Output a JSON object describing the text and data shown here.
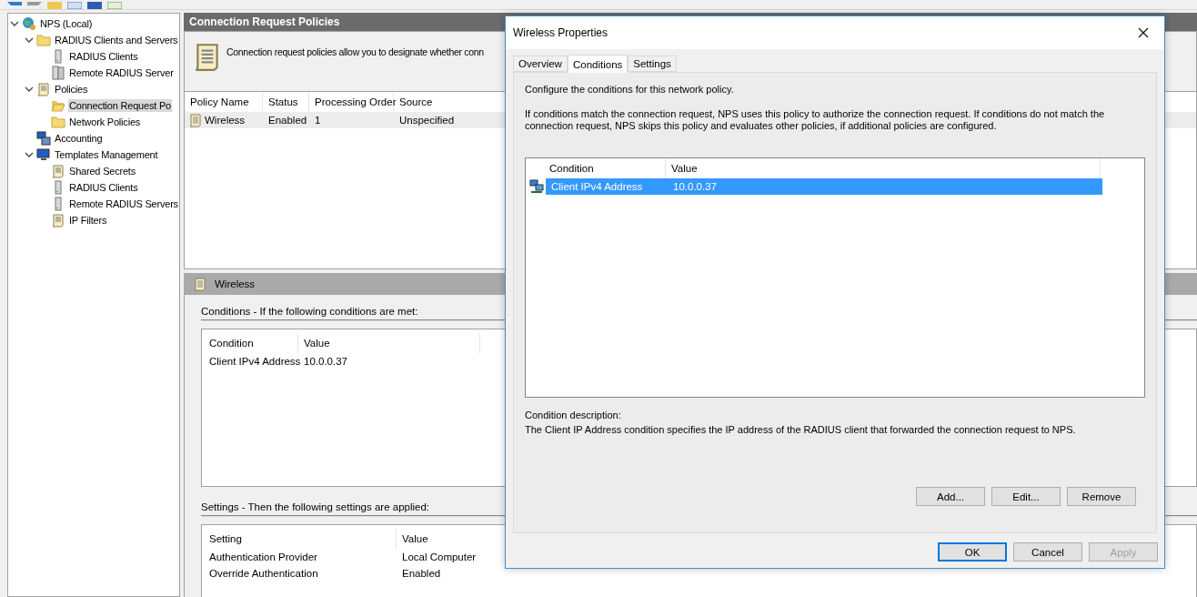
{
  "tree": [
    {
      "label": "NPS (Local)",
      "kind": "globe",
      "selected": false,
      "expanded": true,
      "children": [
        {
          "label": "RADIUS Clients and Servers",
          "kind": "folder",
          "selected": false,
          "expanded": true,
          "children": [
            {
              "label": "RADIUS Clients",
              "kind": "server",
              "selected": false
            },
            {
              "label": "Remote RADIUS Server",
              "kind": "servers",
              "selected": false
            }
          ]
        },
        {
          "label": "Policies",
          "kind": "scroll",
          "selected": false,
          "expanded": true,
          "children": [
            {
              "label": "Connection Request Po",
              "kind": "openfolder",
              "selected": true
            },
            {
              "label": "Network Policies",
              "kind": "folder",
              "selected": false
            }
          ]
        },
        {
          "label": "Accounting",
          "kind": "monitors",
          "selected": false
        },
        {
          "label": "Templates Management",
          "kind": "monitor",
          "selected": false,
          "expanded": true,
          "children": [
            {
              "label": "Shared Secrets",
              "kind": "scroll",
              "selected": false
            },
            {
              "label": "RADIUS Clients",
              "kind": "server",
              "selected": false
            },
            {
              "label": "Remote RADIUS Servers",
              "kind": "server",
              "selected": false
            },
            {
              "label": "IP Filters",
              "kind": "scroll",
              "selected": false
            }
          ]
        }
      ]
    }
  ],
  "main": {
    "title": "Connection Request Policies",
    "intro": "Connection request policies allow you to designate whether conn",
    "policy_table": {
      "columns": [
        "Policy Name",
        "Status",
        "Processing Order",
        "Source"
      ],
      "rows": [
        {
          "cells": [
            "Wireless",
            "Enabled",
            "1",
            "Unspecified"
          ],
          "selected": true
        }
      ]
    },
    "detail_title": "Wireless",
    "conditions_label": "Conditions - If the following conditions are met:",
    "conditions_table": {
      "columns": [
        "Condition",
        "Value"
      ],
      "rows": [
        [
          "Client IPv4 Address",
          "10.0.0.37"
        ]
      ]
    },
    "settings_label": "Settings - Then the following settings are applied:",
    "settings_table": {
      "columns": [
        "Setting",
        "Value"
      ],
      "rows": [
        [
          "Authentication Provider",
          "Local Computer"
        ],
        [
          "Override Authentication",
          "Enabled"
        ]
      ]
    }
  },
  "dialog": {
    "title": "Wireless Properties",
    "tabs": [
      {
        "label": "Overview",
        "selected": false
      },
      {
        "label": "Conditions",
        "selected": true
      },
      {
        "label": "Settings",
        "selected": false
      }
    ],
    "intro": "Configure the conditions for this network policy.",
    "explanation": "If conditions match the connection request, NPS uses this policy to authorize the connection request. If conditions do not match the connection request, NPS skips this policy and evaluates other policies, if additional policies are configured.",
    "table": {
      "columns": [
        "Condition",
        "Value"
      ],
      "rows": [
        {
          "cells": [
            "Client IPv4 Address",
            "10.0.0.37"
          ],
          "selected": true
        }
      ]
    },
    "description_label": "Condition description:",
    "description": "The Client IP Address condition specifies the IP address of the RADIUS client that forwarded the connection request to NPS.",
    "list_buttons": [
      {
        "label": "Add...",
        "disabled": false
      },
      {
        "label": "Edit...",
        "disabled": false
      },
      {
        "label": "Remove",
        "disabled": false
      }
    ],
    "buttons": [
      {
        "label": "OK",
        "default": true,
        "disabled": false
      },
      {
        "label": "Cancel",
        "default": false,
        "disabled": false
      },
      {
        "label": "Apply",
        "default": false,
        "disabled": true
      }
    ]
  }
}
